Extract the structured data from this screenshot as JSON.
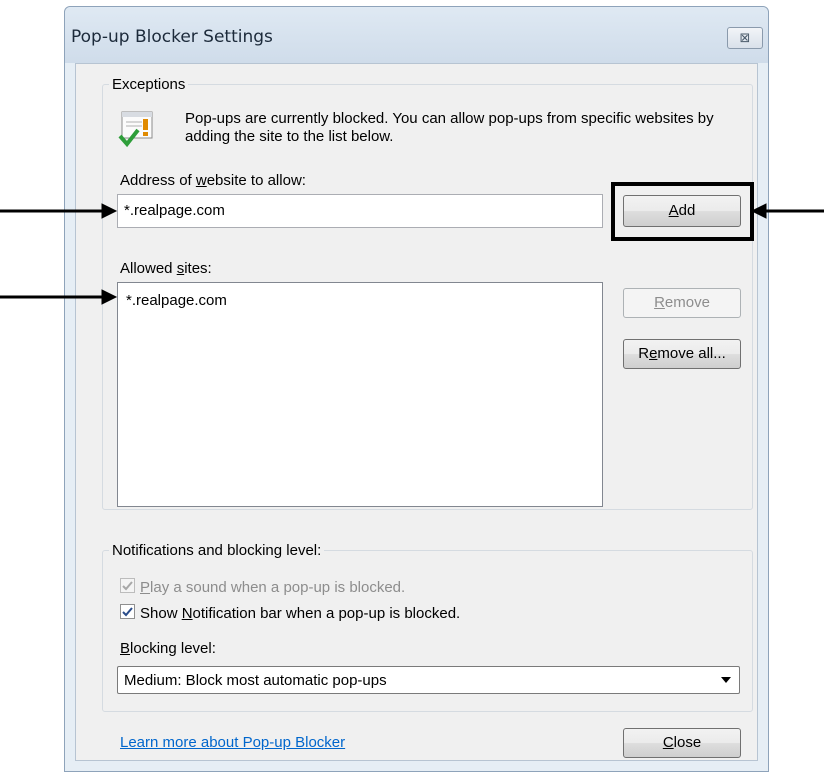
{
  "dialog": {
    "title": "Pop-up Blocker Settings",
    "close_glyph": "⊠"
  },
  "exceptions": {
    "group_title": "Exceptions",
    "description": "Pop-ups are currently blocked.  You can allow pop-ups from specific websites by adding the site to the list below.",
    "address_label_pre": "Address of ",
    "address_label_u": "w",
    "address_label_post": "ebsite to allow:",
    "address_value": "*.realpage.com",
    "add_button": {
      "u": "A",
      "rest": "dd"
    },
    "allowed_label_pre": "Allowed ",
    "allowed_label_u": "s",
    "allowed_label_post": "ites:",
    "allowed_sites": [
      "*.realpage.com"
    ],
    "remove_button": {
      "u": "R",
      "rest": "emove"
    },
    "remove_all_button": {
      "pre": "R",
      "u": "e",
      "rest": "move all..."
    }
  },
  "notifications": {
    "group_title": "Notifications and blocking level:",
    "play_sound": {
      "u": "P",
      "rest": "lay a sound when a pop-up is blocked.",
      "checked": true,
      "enabled": false
    },
    "show_bar": {
      "pre": "Show ",
      "u": "N",
      "rest": "otification bar when a pop-up is blocked.",
      "checked": true,
      "enabled": true
    },
    "blocking_label": {
      "u": "B",
      "rest": "locking level:"
    },
    "blocking_level": "Medium: Block most automatic pop-ups"
  },
  "footer": {
    "learn_more": "Learn more about Pop-up Blocker",
    "close_button": {
      "u": "C",
      "rest": "lose"
    }
  },
  "colors": {
    "link": "#0066cc",
    "check_green": "#2e9e3a",
    "warn_orange": "#e08a00"
  }
}
